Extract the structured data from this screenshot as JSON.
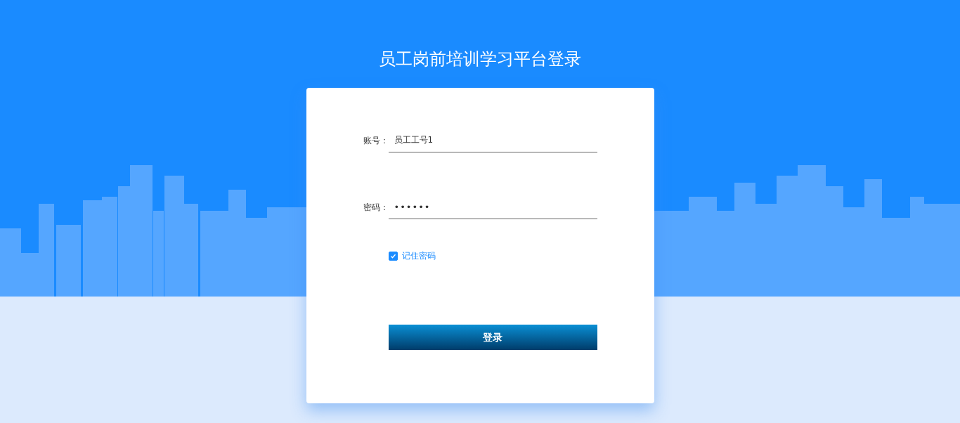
{
  "title": "员工岗前培训学习平台登录",
  "fields": [
    {
      "kind": "text",
      "label": "账号：",
      "value": "员工工号1"
    },
    {
      "kind": "password",
      "label": "密码：",
      "value": "••••••"
    }
  ],
  "remember": {
    "label": "记住密码",
    "checked": true
  },
  "button": {
    "label": "登录"
  }
}
